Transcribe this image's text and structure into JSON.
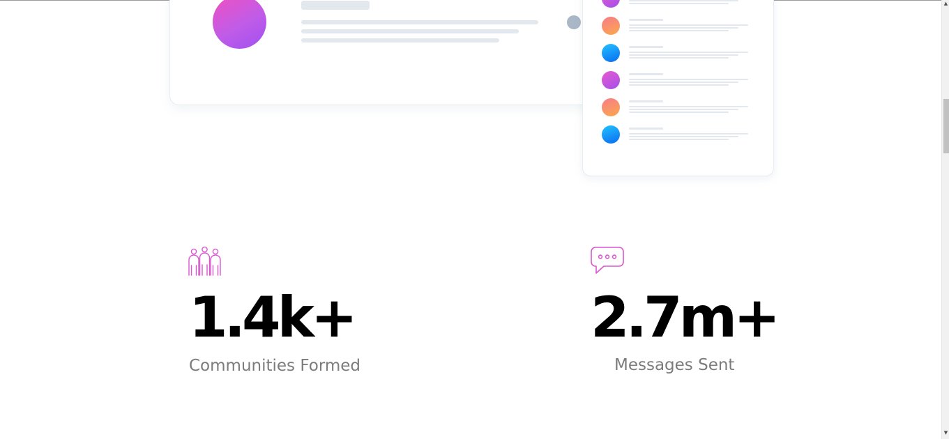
{
  "stats": [
    {
      "value": "1.4k+",
      "label": "Communities Formed",
      "icon": "people-icon"
    },
    {
      "value": "2.7m+",
      "label": "Messages Sent",
      "icon": "chat-bubble-icon"
    }
  ],
  "mockup": {
    "list_avatars": [
      "purple",
      "orange",
      "blue",
      "purple",
      "orange",
      "blue"
    ]
  },
  "colors": {
    "accent": "#d957cf",
    "stat_value": "#000000",
    "stat_label": "#7c7c7c"
  },
  "scrollbar": {
    "up_arrow": "▲",
    "down_arrow": "▼"
  }
}
